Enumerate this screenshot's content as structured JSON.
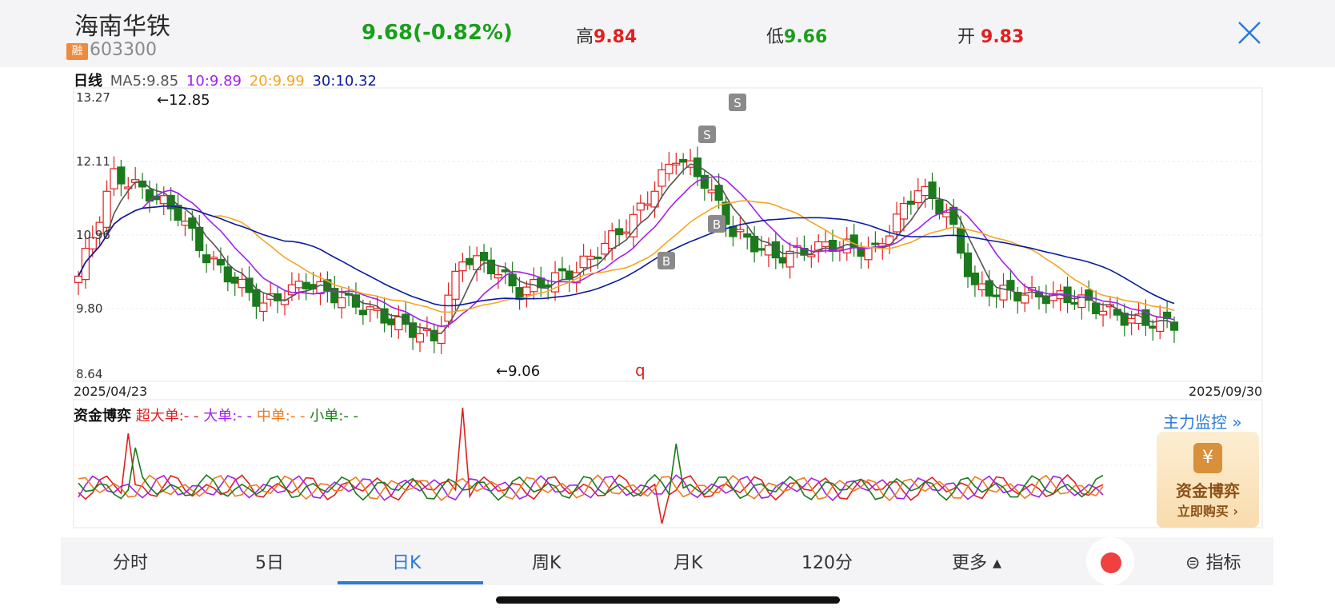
{
  "header": {
    "stock_name": "海南华铁",
    "badge": "融",
    "code": "603300",
    "price": "9.68",
    "change": "(-0.82%)",
    "high_label": "高",
    "high_value": "9.84",
    "low_label": "低",
    "low_value": "9.66",
    "open_label": "开",
    "open_value": "9.83",
    "close_icon": "close-icon"
  },
  "chart_legend": {
    "period": "日线",
    "ma5": "MA5:9.85",
    "ma10": "10:9.89",
    "ma20": "20:9.99",
    "ma30": "30:10.32"
  },
  "colors": {
    "up": "#e02020",
    "down": "#1b7a1b",
    "ma5": "#555555",
    "ma10": "#a020f0",
    "ma20": "#f5a623",
    "ma30": "#0a1aa0",
    "accent": "#2a7ad6"
  },
  "chart_data": [
    {
      "type": "candlestick",
      "title": "日线",
      "ylim": [
        8.64,
        13.27
      ],
      "y_ticks": [
        "13.27",
        "12.11",
        "10.96",
        "9.80",
        "8.64"
      ],
      "x_start": "2025/04/23",
      "x_end": "2025/09/30",
      "annotations": {
        "max_label": "←12.85",
        "min_label": "←9.06",
        "marker": "q",
        "buy_label": "B",
        "sell_label": "S"
      },
      "series": [
        {
          "name": "MA5",
          "value": 9.85
        },
        {
          "name": "10",
          "value": 9.89
        },
        {
          "name": "20",
          "value": 9.99
        },
        {
          "name": "30",
          "value": 10.32
        }
      ]
    },
    {
      "type": "line",
      "title": "资金博弈",
      "legend": [
        "超大单:- -",
        "大单:- -",
        "中单:- -",
        "小单:- -"
      ]
    }
  ],
  "fund_panel": {
    "title": "资金博弈",
    "super_large": "超大单:- -",
    "large": "大单:- -",
    "medium": "中单:- -",
    "small": "小单:- -",
    "monitor_link": "主力监控 »",
    "promo_title": "资金博弈",
    "promo_action": "立即购买 ›",
    "promo_coin": "¥"
  },
  "tabs": {
    "t1": "分时",
    "t2": "5日",
    "t3": "日K",
    "t4": "周K",
    "t5": "月K",
    "t6": "120分",
    "t7": "更多 ▴",
    "indicator": "指标"
  }
}
